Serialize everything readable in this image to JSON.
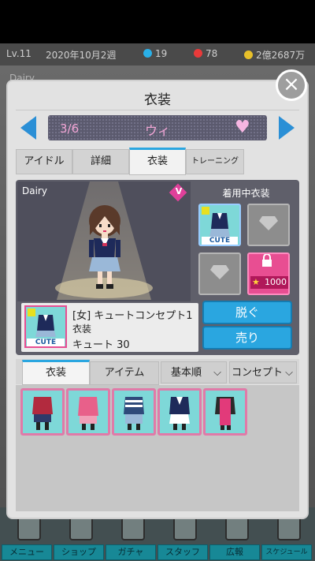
{
  "status": {
    "level": "Lv.11",
    "date": "2020年10月2週",
    "gems": "19",
    "stars": "78",
    "money": "2億2687万"
  },
  "background": {
    "group_label": "Dairy"
  },
  "modal": {
    "title": "衣装",
    "close_label": "×",
    "counter": "3/6",
    "idol_name": "ウィ",
    "tabs": [
      {
        "label": "アイドル"
      },
      {
        "label": "詳細"
      },
      {
        "label": "衣装"
      },
      {
        "label": "トレーニング"
      }
    ],
    "active_tab": "衣装",
    "group_name": "Dairy",
    "v_badge": "V",
    "equipped_title": "着用中衣装",
    "locked_cost": "1000",
    "thumb_tag": "CUTE",
    "item": {
      "name": "[女] キュートコンセプト1",
      "category": "衣装",
      "stat": "キュート 30"
    },
    "buttons": {
      "take_off": "脱ぐ",
      "sell": "売り"
    },
    "list_tabs": [
      {
        "label": "衣装"
      },
      {
        "label": "アイテム"
      }
    ],
    "sort_primary": "基本順",
    "sort_secondary": "コンセプト",
    "list_items": [
      {
        "color": "#b22a3e"
      },
      {
        "color": "#e8608a"
      },
      {
        "color": "#2e4a7a"
      },
      {
        "color": "#1e2a5a"
      },
      {
        "color": "#e23a7a"
      }
    ]
  },
  "bottom_nav": [
    {
      "label": "メニュー"
    },
    {
      "label": "ショップ"
    },
    {
      "label": "ガチャ"
    },
    {
      "label": "スタッフ"
    },
    {
      "label": "広報"
    },
    {
      "label": "スケジュール"
    }
  ],
  "colors": {
    "accent_blue": "#2aa6e0",
    "pink": "#e84e92",
    "cyan": "#7ed8d8"
  }
}
